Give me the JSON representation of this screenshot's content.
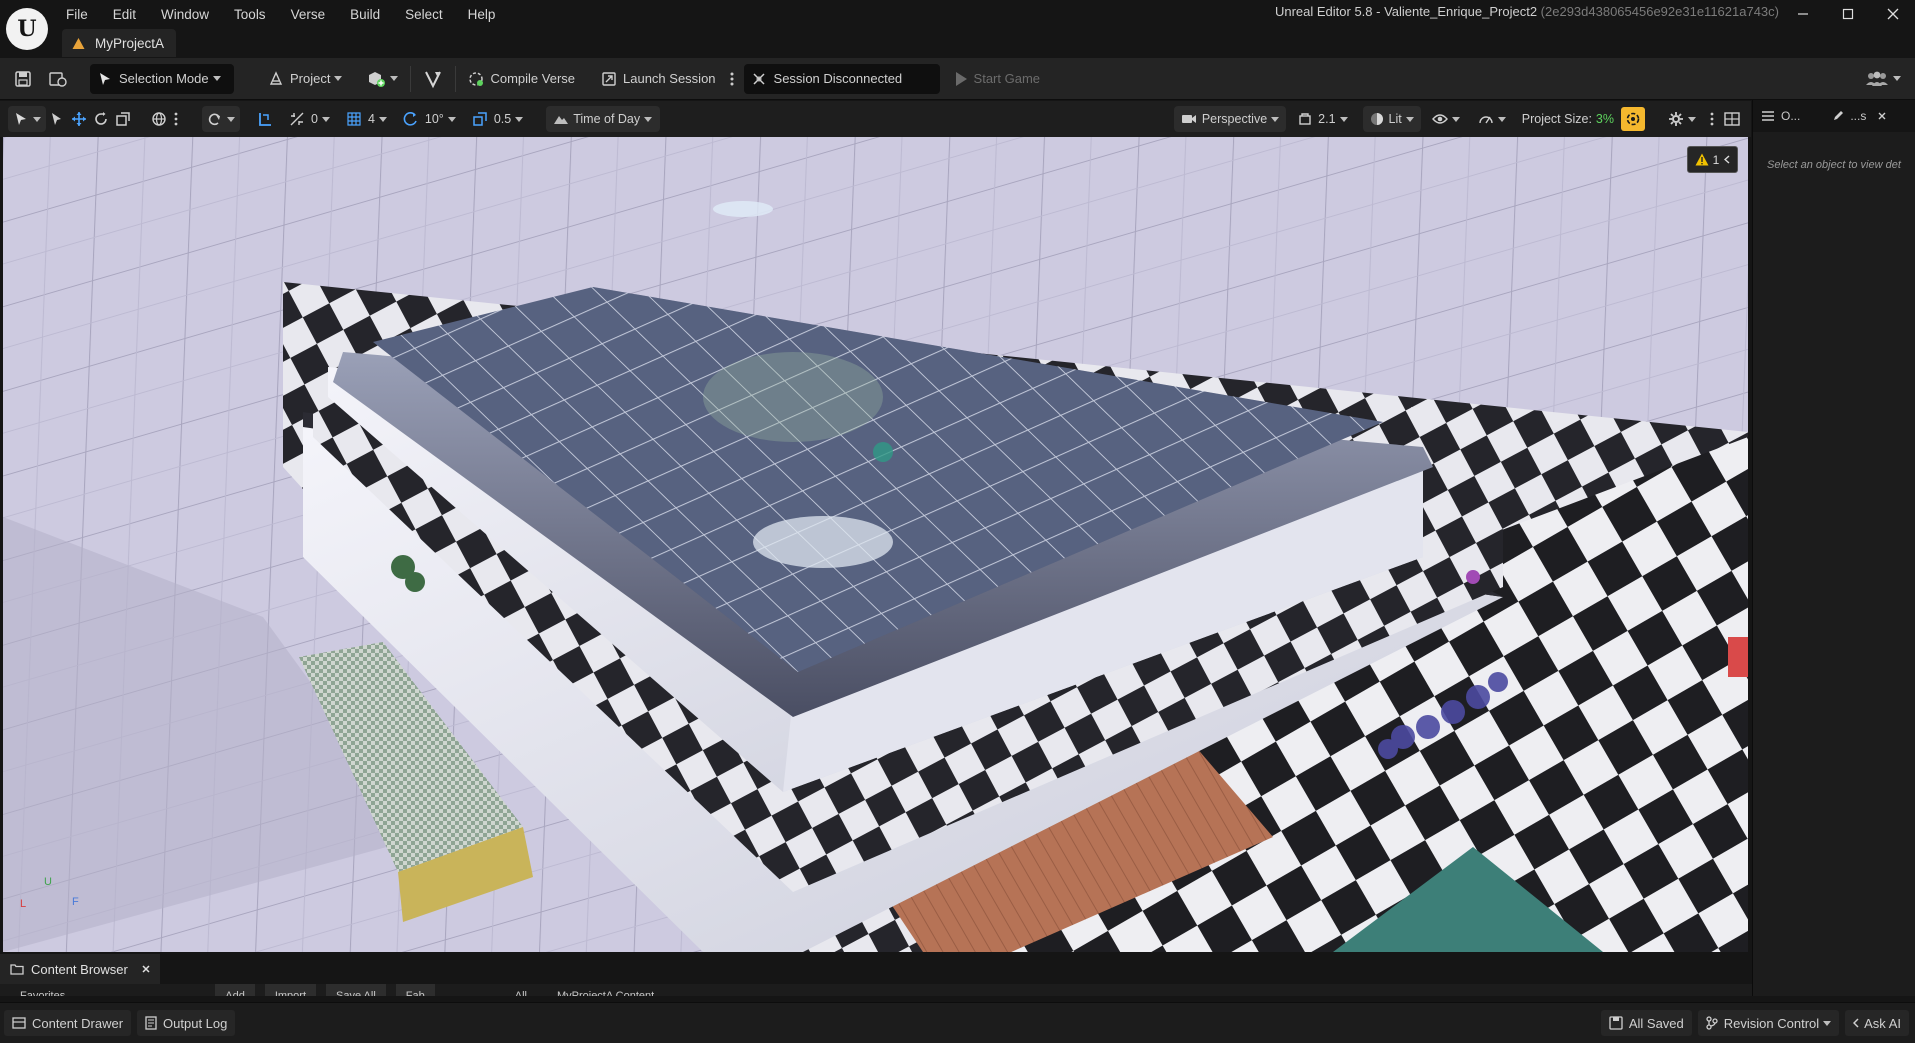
{
  "window": {
    "app_title": "Unreal Editor 5.8 - Valiente_Enrique_Project2",
    "hash": "(2e293d438065456e92e31e11621a743c)",
    "logo_letter": "U"
  },
  "menu": [
    "File",
    "Edit",
    "Window",
    "Tools",
    "Verse",
    "Build",
    "Select",
    "Help"
  ],
  "document_tab": {
    "label": "MyProjectA"
  },
  "main_toolbar": {
    "selection_mode": "Selection Mode",
    "project": "Project",
    "compile_verse": "Compile Verse",
    "launch_session": "Launch Session",
    "session_status": "Session Disconnected",
    "start_game": "Start Game"
  },
  "viewport_toolbar": {
    "rotation_value": "0",
    "grid_value": "4",
    "rot_snap": "10°",
    "scale_snap": "0.5",
    "time_of_day": "Time of Day",
    "perspective": "Perspective",
    "fov": "2.1",
    "lit": "Lit",
    "project_size_label": "Project Size:",
    "project_size_value": "3%"
  },
  "viewport": {
    "warning_count": "1",
    "axis_z": "U",
    "axis_x": "L",
    "axis_y": "F"
  },
  "details_panel": {
    "tab1": "O...",
    "tab2": "...s",
    "empty_text": "Select an object to view det"
  },
  "content_browser": {
    "tab_label": "Content Browser",
    "sub_items": [
      "Favorites",
      "Add",
      "Import",
      "Save All",
      "Fab",
      "All",
      "MyProjectA Content"
    ]
  },
  "status_bar": {
    "content_drawer": "Content Drawer",
    "output_log": "Output Log",
    "all_saved": "All Saved",
    "revision_control": "Revision Control",
    "ask_ai": "Ask AI"
  },
  "colors": {
    "accent_yellow": "#f5b82e",
    "project_size_green": "#5ed35e",
    "warning_yellow": "#f2c200"
  }
}
